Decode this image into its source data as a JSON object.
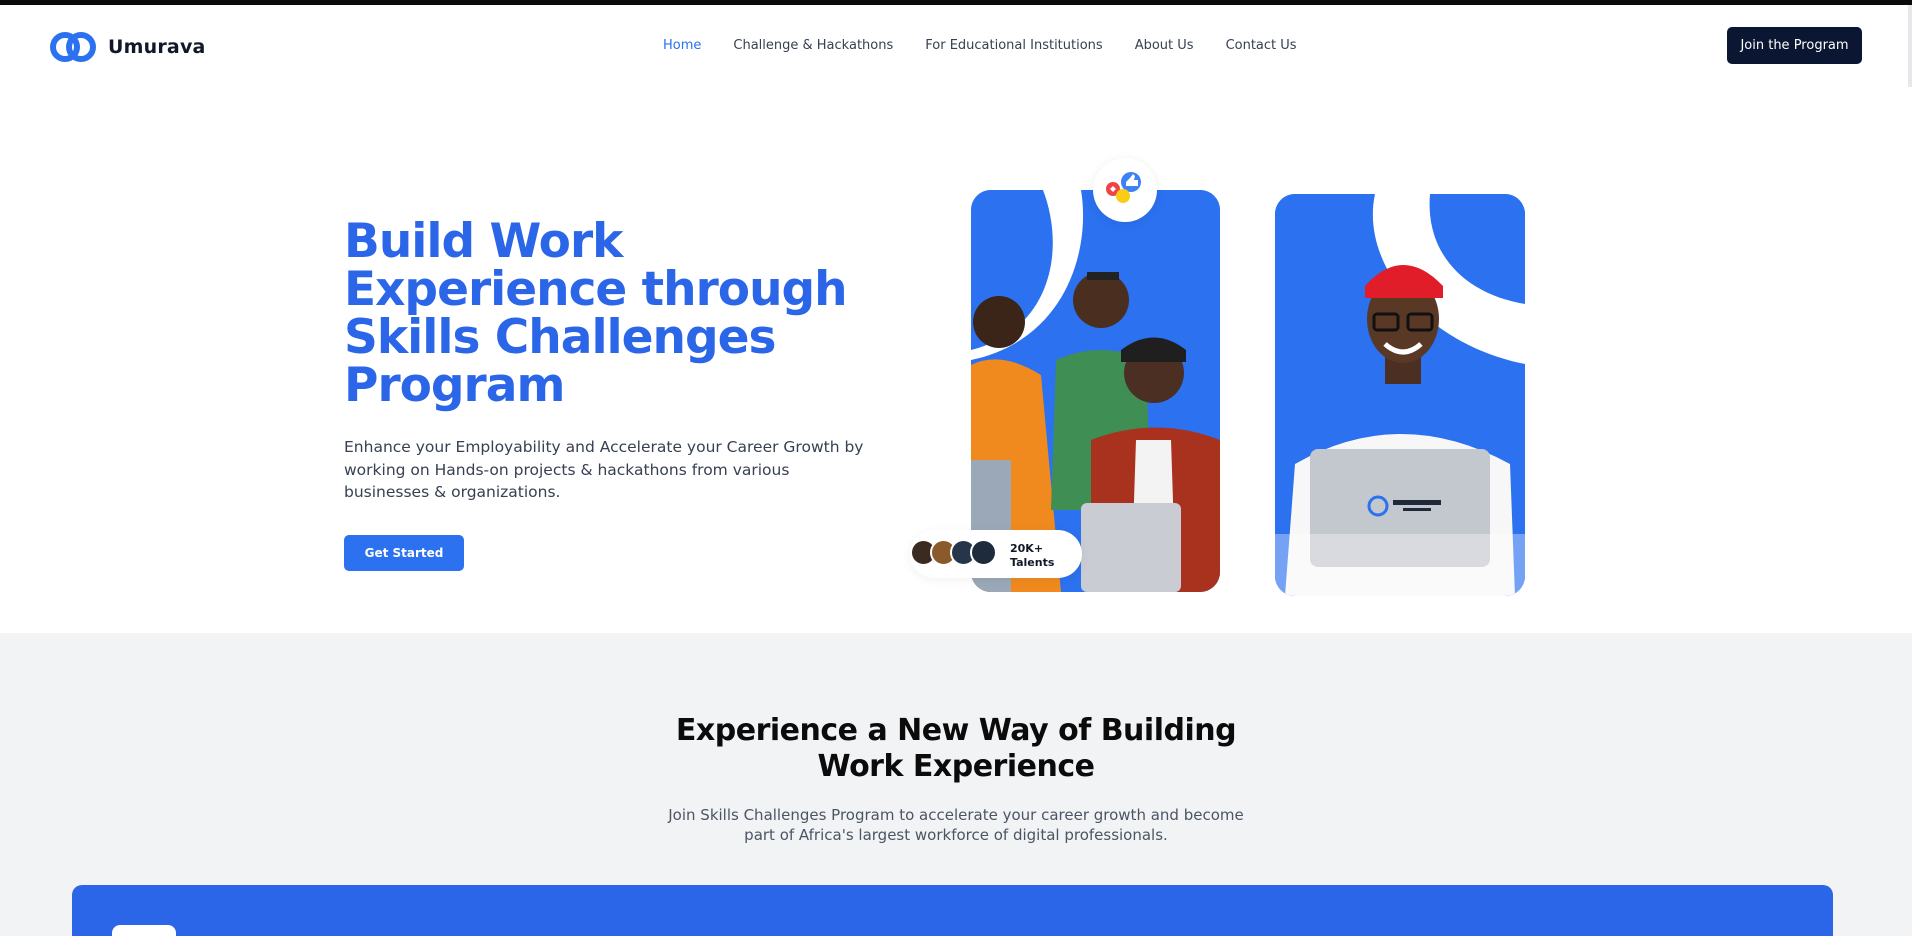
{
  "brand": {
    "name": "Umurava",
    "color": "#2b71f0"
  },
  "nav": {
    "items": [
      {
        "label": "Home",
        "active": true
      },
      {
        "label": "Challenge & Hackathons",
        "active": false
      },
      {
        "label": "For Educational Institutions",
        "active": false
      },
      {
        "label": "About Us",
        "active": false
      },
      {
        "label": "Contact Us",
        "active": false
      }
    ],
    "cta_label": "Join the Program"
  },
  "hero": {
    "title_lines": [
      "Build Work",
      "Experience through",
      "Skills Challenges",
      "Program"
    ],
    "subtitle": "Enhance your Employability and Accelerate your Career Growth by working on Hands-on projects & hackathons from various businesses & organizations.",
    "cta_label": "Get Started",
    "talents_count": "20K+",
    "talents_label": "Talents"
  },
  "section2": {
    "title_lines": [
      "Experience a New Way of Building",
      "Work Experience"
    ],
    "subtitle_lines": [
      "Join Skills Challenges Program to accelerate your career growth and become",
      "part of Africa's largest workforce of digital professionals."
    ]
  },
  "colors": {
    "accent": "#2b71f0",
    "heading_blue": "#2b66e8",
    "navy": "#0b1633",
    "section_bg": "#f2f3f5"
  }
}
